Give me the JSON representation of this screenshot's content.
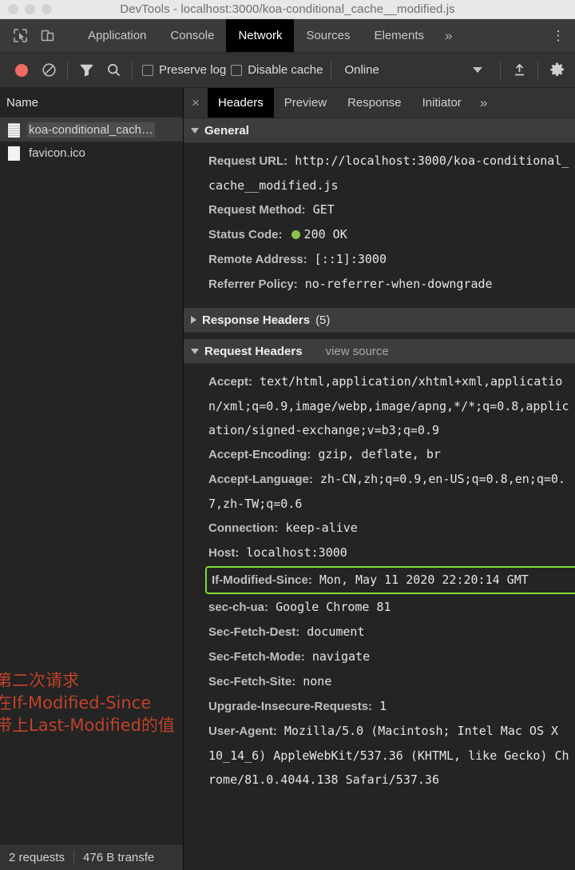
{
  "window": {
    "title": "DevTools - localhost:3000/koa-conditional_cache__modified.js",
    "traffic_lights": [
      "close",
      "minimize",
      "zoom"
    ]
  },
  "main_tabs": {
    "inspect_icon": "inspect-element-icon",
    "device_icon": "device-toolbar-icon",
    "items": [
      {
        "label": "Application",
        "active": false
      },
      {
        "label": "Console",
        "active": false
      },
      {
        "label": "Network",
        "active": true
      },
      {
        "label": "Sources",
        "active": false
      },
      {
        "label": "Elements",
        "active": false
      }
    ],
    "more_label": "»",
    "menu_label": "⋮"
  },
  "network_toolbar": {
    "record_icon": "record-icon",
    "clear_icon": "clear-icon",
    "filter_icon": "filter-icon",
    "search_icon": "search-icon",
    "preserve_log": {
      "label": "Preserve log",
      "checked": false
    },
    "disable_cache": {
      "label": "Disable cache",
      "checked": false
    },
    "throttling": {
      "value": "Online"
    },
    "import_icon": "upload-icon",
    "settings_icon": "gear-icon"
  },
  "requests_pane": {
    "column_header": "Name",
    "rows": [
      {
        "name": "koa-conditional_cach…",
        "icon": "js-file-icon",
        "selected": true
      },
      {
        "name": "favicon.ico",
        "icon": "file-icon",
        "selected": false
      }
    ]
  },
  "annotation": {
    "lines": [
      "第二次请求",
      "在If-Modified-Since",
      "带上Last-Modified的值"
    ],
    "color": "#c0442c"
  },
  "status_bar": {
    "requests": "2 requests",
    "transferred": "476 B transfe"
  },
  "details_pane": {
    "close_label": "×",
    "tabs": [
      {
        "label": "Headers",
        "active": true
      },
      {
        "label": "Preview",
        "active": false
      },
      {
        "label": "Response",
        "active": false
      },
      {
        "label": "Initiator",
        "active": false
      }
    ],
    "more_label": "»",
    "sections": [
      {
        "title": "General",
        "expanded": true,
        "count": "",
        "view_source": "",
        "rows": [
          {
            "name": "Request URL:",
            "value": "http://localhost:3000/koa-conditional_cache__modified.js"
          },
          {
            "name": "Request Method:",
            "value": "GET"
          },
          {
            "name": "Status Code:",
            "value": "200 OK",
            "status_dot": "#8ac44d"
          },
          {
            "name": "Remote Address:",
            "value": "[::1]:3000"
          },
          {
            "name": "Referrer Policy:",
            "value": "no-referrer-when-downgrade"
          }
        ]
      },
      {
        "title": "Response Headers",
        "expanded": false,
        "count": "(5)",
        "view_source": "",
        "rows": []
      },
      {
        "title": "Request Headers",
        "expanded": true,
        "count": "",
        "view_source": "view source",
        "rows": [
          {
            "name": "Accept:",
            "value": "text/html,application/xhtml+xml,application/xml;q=0.9,image/webp,image/apng,*/*;q=0.8,application/signed-exchange;v=b3;q=0.9"
          },
          {
            "name": "Accept-Encoding:",
            "value": "gzip, deflate, br"
          },
          {
            "name": "Accept-Language:",
            "value": "zh-CN,zh;q=0.9,en-US;q=0.8,en;q=0.7,zh-TW;q=0.6"
          },
          {
            "name": "Connection:",
            "value": "keep-alive"
          },
          {
            "name": "Host:",
            "value": "localhost:3000"
          },
          {
            "name": "If-Modified-Since:",
            "value": "Mon, May 11 2020 22:20:14 GMT",
            "highlight": "#7ddc3a"
          },
          {
            "name": "sec-ch-ua:",
            "value": "Google Chrome 81"
          },
          {
            "name": "Sec-Fetch-Dest:",
            "value": "document"
          },
          {
            "name": "Sec-Fetch-Mode:",
            "value": "navigate"
          },
          {
            "name": "Sec-Fetch-Site:",
            "value": "none"
          },
          {
            "name": "Upgrade-Insecure-Requests:",
            "value": "1"
          },
          {
            "name": "User-Agent:",
            "value": "Mozilla/5.0 (Macintosh; Intel Mac OS X 10_14_6) AppleWebKit/537.36 (KHTML, like Gecko) Chrome/81.0.4044.138 Safari/537.36"
          }
        ]
      }
    ]
  }
}
